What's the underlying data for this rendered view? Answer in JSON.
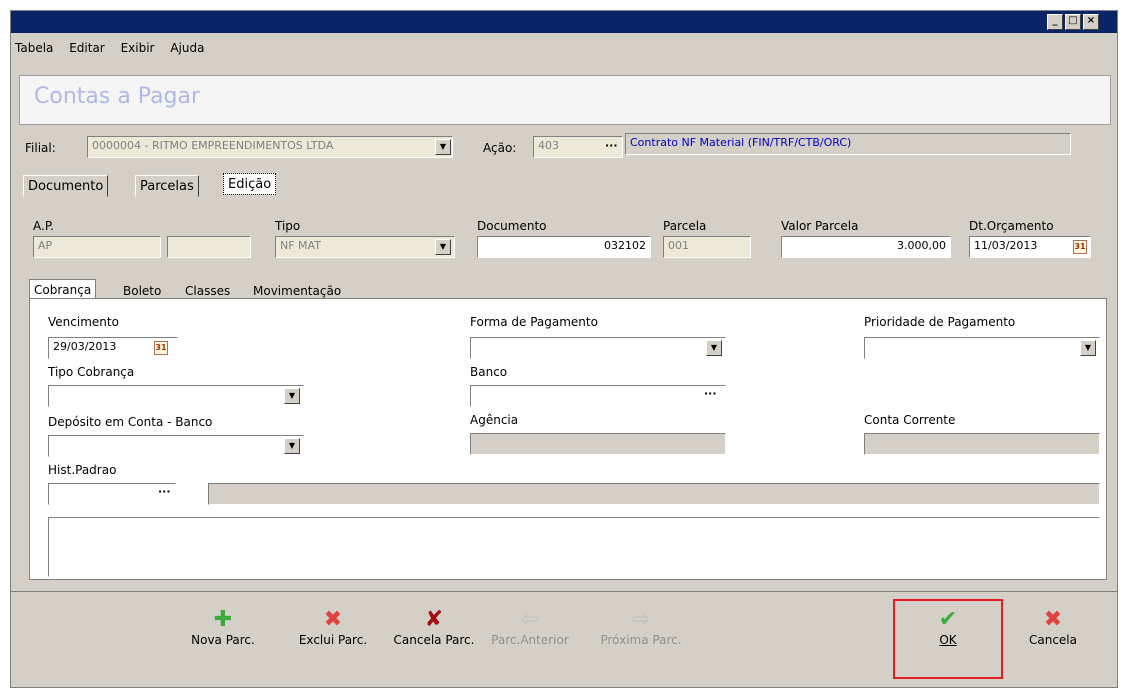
{
  "menu": [
    "Tabela",
    "Editar",
    "Exibir",
    "Ajuda"
  ],
  "window_controls": {
    "minimize": "_",
    "maximize": "□",
    "close": "×"
  },
  "header": {
    "title": "Contas a Pagar"
  },
  "filial": {
    "label": "Filial:",
    "value": "0000004 - RITMO EMPREENDIMENTOS LTDA"
  },
  "acao": {
    "label": "Ação:",
    "code": "403",
    "description": "Contrato NF Material (FIN/TRF/CTB/ORC)"
  },
  "tabs": [
    "Documento",
    "Parcelas",
    "Edição"
  ],
  "doc": {
    "ap_label": "A.P.",
    "ap_value": "AP",
    "ap_value2": "",
    "tipo_label": "Tipo",
    "tipo_value": "NF MAT",
    "documento_label": "Documento",
    "documento_value": "032102",
    "parcela_label": "Parcela",
    "parcela_value": "001",
    "valor_label": "Valor Parcela",
    "valor_value": "3.000,00",
    "dt_label": "Dt.Orçamento",
    "dt_value": "11/03/2013"
  },
  "subtabs": [
    "Cobrança",
    "Boleto",
    "Classes",
    "Movimentação"
  ],
  "cobranca": {
    "vencimento_label": "Vencimento",
    "vencimento_value": "29/03/2013",
    "forma_label": "Forma de Pagamento",
    "forma_value": "",
    "prioridade_label": "Prioridade de Pagamento",
    "prioridade_value": "",
    "tipo_cobranca_label": "Tipo Cobrança",
    "tipo_cobranca_value": "",
    "banco_label": "Banco",
    "banco_value": "",
    "deposito_label": "Depósito em Conta - Banco",
    "deposito_value": "",
    "agencia_label": "Agência",
    "agencia_value": "",
    "conta_label": "Conta Corrente",
    "conta_value": "",
    "hist_label": "Hist.Padrao",
    "hist_value": "",
    "hist_desc": ""
  },
  "toolbar": {
    "nova": "Nova Parc.",
    "exclui": "Exclui Parc.",
    "cancela_parc": "Cancela Parc.",
    "anterior": "Parc.Anterior",
    "proxima": "Próxima Parc.",
    "ok": "OK",
    "cancela": "Cancela"
  },
  "icons": {
    "plus": "plus-icon",
    "x-red": "x-icon",
    "x-dark": "x-icon",
    "arrow-left": "arrow-left-icon",
    "arrow-right": "arrow-right-icon",
    "check": "check-icon"
  },
  "colors": {
    "titlebar": "#0a246a",
    "highlight": "#e02020",
    "green": "#3caa3c",
    "red": "#e04040",
    "darkred": "#a01010",
    "link_blue": "#0000c0"
  }
}
